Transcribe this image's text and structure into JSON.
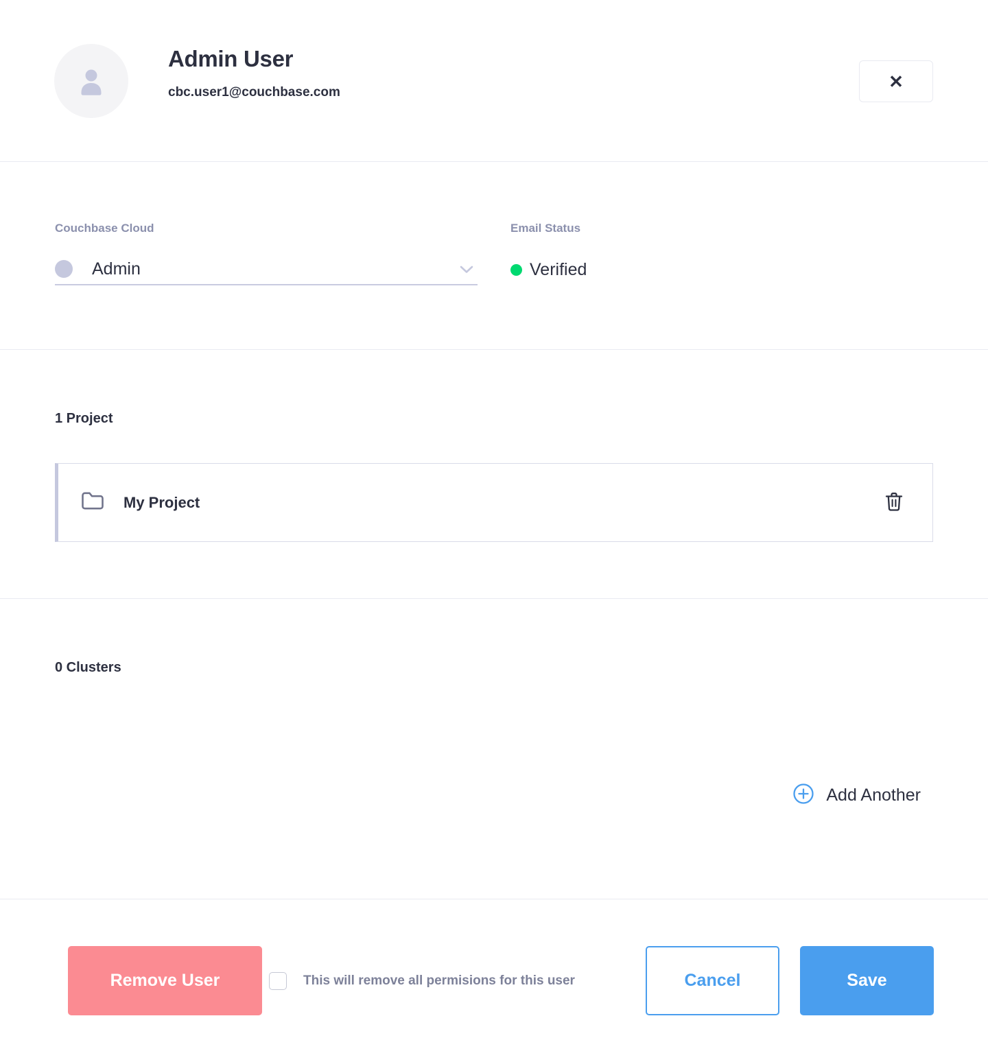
{
  "header": {
    "user_name": "Admin User",
    "user_email": "cbc.user1@couchbase.com",
    "avatar_icon": "person-avatar-icon",
    "close_label": "✕",
    "close_icon": "close-icon"
  },
  "role_section": {
    "role_field": {
      "label": "Couchbase Cloud",
      "value": "Admin",
      "dot_color": "#c5c8de",
      "chevron_icon": "chevron-down-icon"
    },
    "status_field": {
      "label": "Email Status",
      "value": "Verified",
      "dot_color": "#00d970"
    }
  },
  "projects_section": {
    "title": "1 Project",
    "projects": [
      {
        "name": "My Project",
        "folder_icon": "folder-icon",
        "delete_icon": "trash-icon"
      }
    ]
  },
  "clusters_section": {
    "title": "0 Clusters",
    "add_another": {
      "label": "Add Another",
      "icon": "plus-circle-icon",
      "color": "#4a9eee"
    }
  },
  "footer": {
    "remove_user_label": "Remove User",
    "remove_user_color": "#fb8b92",
    "remove_confirm_label": "This will remove all permisions for this user",
    "remove_checkbox_checked": false,
    "cancel_label": "Cancel",
    "save_label": "Save",
    "accent_color": "#4a9eee"
  }
}
